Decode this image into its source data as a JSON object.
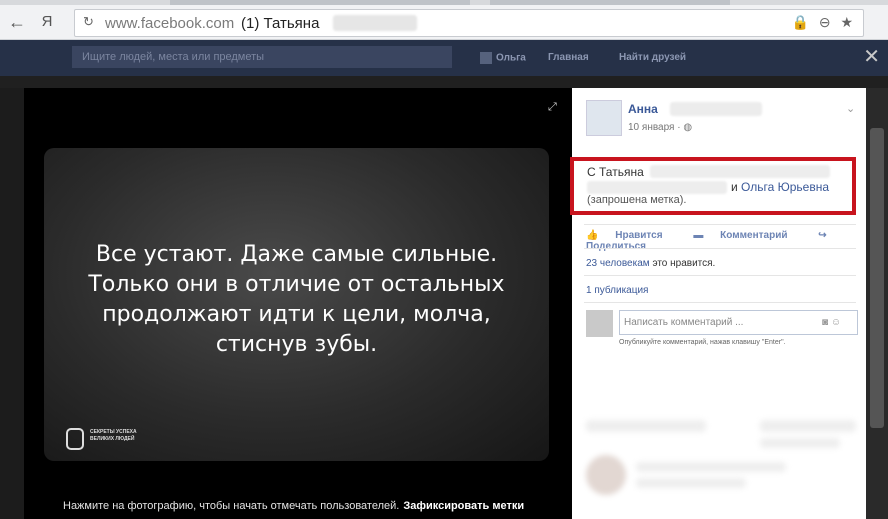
{
  "browser": {
    "back": "←",
    "yandex_button": "Я",
    "url_host": "www.facebook.com",
    "tab_title": "(1) Татьяна"
  },
  "fb_header": {
    "search_placeholder": "Ищите людей, места или предметы",
    "nav_user": "Ольга",
    "nav_home": "Главная",
    "nav_friends": "Найти друзей"
  },
  "photo": {
    "quote_lines": [
      "Все устают. Даже самые сильные.",
      "Только они в отличие от остальных",
      "продолжают идти к цели, молча,",
      "стиснув зубы."
    ],
    "logo_line1": "СЕКРЕТЫ УСПЕХА",
    "logo_line2": "ВЕЛИКИХ ЛЮДЕЙ",
    "tag_hint": "Нажмите на фотографию, чтобы начать отмечать пользователей.",
    "tag_done": "Зафиксировать метки"
  },
  "post": {
    "author": "Анна",
    "date": "10 января",
    "date_sep": "·",
    "with_prefix": "С Татьяна",
    "and": "и",
    "tagged_user": "Ольга Юрьевна",
    "tag_status": "(запрошена метка).",
    "like": "Нравится",
    "comment": "Комментарий",
    "share": "Поделиться",
    "likes_count": "23 человекам",
    "likes_suffix": "это нравится.",
    "shares_count": "1 публикация",
    "comment_placeholder": "Написать комментарий ...",
    "comment_hint": "Опубликуйте комментарий, нажав клавишу \"Enter\"."
  }
}
